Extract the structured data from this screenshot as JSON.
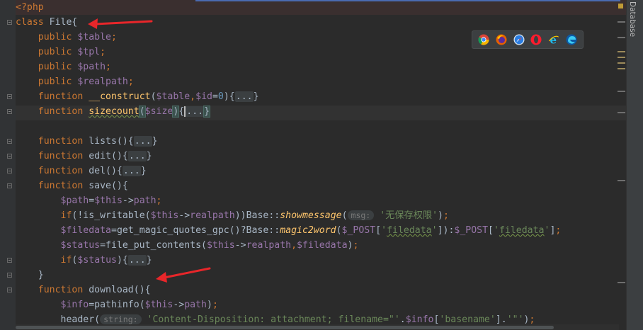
{
  "editor": {
    "language": "php",
    "side_tab_label": "Database",
    "lines": [
      [
        [
          "kw",
          "<?php"
        ]
      ],
      [
        [
          "kw",
          "class "
        ],
        [
          "plain",
          "File{"
        ]
      ],
      [
        [
          "plain",
          "    "
        ],
        [
          "kw",
          "public "
        ],
        [
          "var",
          "$table"
        ],
        [
          "kw",
          ";"
        ]
      ],
      [
        [
          "plain",
          "    "
        ],
        [
          "kw",
          "public "
        ],
        [
          "var",
          "$tpl"
        ],
        [
          "kw",
          ";"
        ]
      ],
      [
        [
          "plain",
          "    "
        ],
        [
          "kw",
          "public "
        ],
        [
          "var",
          "$path"
        ],
        [
          "kw",
          ";"
        ]
      ],
      [
        [
          "plain",
          "    "
        ],
        [
          "kw",
          "public "
        ],
        [
          "var",
          "$realpath"
        ],
        [
          "kw",
          ";"
        ]
      ],
      [
        [
          "plain",
          "    "
        ],
        [
          "kw",
          "function "
        ],
        [
          "fn",
          "__construct"
        ],
        [
          "plain",
          "("
        ],
        [
          "var",
          "$table"
        ],
        [
          "kw",
          ","
        ],
        [
          "var",
          "$id"
        ],
        [
          "plain",
          "="
        ],
        [
          "num",
          "0"
        ],
        [
          "plain",
          "){"
        ],
        [
          "fold",
          "..."
        ],
        [
          "plain",
          "}"
        ]
      ],
      [
        [
          "plain",
          "    "
        ],
        [
          "kw",
          "function "
        ],
        [
          "fnsq",
          "sizecount"
        ],
        [
          "match",
          "("
        ],
        [
          "var",
          "$size"
        ],
        [
          "match",
          ")"
        ],
        [
          "plain",
          "{"
        ],
        [
          "caret",
          ""
        ],
        [
          "fold",
          "..."
        ],
        [
          "match",
          "}"
        ]
      ],
      [],
      [
        [
          "plain",
          "    "
        ],
        [
          "kw",
          "function "
        ],
        [
          "plain",
          "lists(){"
        ],
        [
          "fold",
          "..."
        ],
        [
          "plain",
          "}"
        ]
      ],
      [
        [
          "plain",
          "    "
        ],
        [
          "kw",
          "function "
        ],
        [
          "plain",
          "edit(){"
        ],
        [
          "fold",
          "..."
        ],
        [
          "plain",
          "}"
        ]
      ],
      [
        [
          "plain",
          "    "
        ],
        [
          "kw",
          "function "
        ],
        [
          "plain",
          "del(){"
        ],
        [
          "fold",
          "..."
        ],
        [
          "plain",
          "}"
        ]
      ],
      [
        [
          "plain",
          "    "
        ],
        [
          "kw",
          "function "
        ],
        [
          "plain",
          "save(){"
        ]
      ],
      [
        [
          "plain",
          "        "
        ],
        [
          "var",
          "$path"
        ],
        [
          "plain",
          "="
        ],
        [
          "var",
          "$this"
        ],
        [
          "plain",
          "->"
        ],
        [
          "var",
          "path"
        ],
        [
          "kw",
          ";"
        ]
      ],
      [
        [
          "plain",
          "        "
        ],
        [
          "kw",
          "if"
        ],
        [
          "plain",
          "(!is_writable("
        ],
        [
          "var",
          "$this"
        ],
        [
          "plain",
          "->"
        ],
        [
          "var",
          "realpath"
        ],
        [
          "plain",
          "))Base::"
        ],
        [
          "static",
          "showmessage"
        ],
        [
          "plain",
          "("
        ],
        [
          "hint",
          "msg:"
        ],
        [
          "plain",
          " "
        ],
        [
          "str",
          "'无保存权限'"
        ],
        [
          "plain",
          ")"
        ],
        [
          "kw",
          ";"
        ]
      ],
      [
        [
          "plain",
          "        "
        ],
        [
          "var",
          "$filedata"
        ],
        [
          "plain",
          "=get_magic_quotes_gpc()?Base::"
        ],
        [
          "static",
          "magic2word"
        ],
        [
          "plain",
          "("
        ],
        [
          "var",
          "$_POST"
        ],
        [
          "plain",
          "["
        ],
        [
          "str",
          "'"
        ],
        [
          "strsq",
          "filedata"
        ],
        [
          "str",
          "'"
        ],
        [
          "plain",
          "]):"
        ],
        [
          "var",
          "$_POST"
        ],
        [
          "plain",
          "["
        ],
        [
          "str",
          "'"
        ],
        [
          "strsq",
          "filedata"
        ],
        [
          "str",
          "'"
        ],
        [
          "plain",
          "]"
        ],
        [
          "kw",
          ";"
        ]
      ],
      [
        [
          "plain",
          "        "
        ],
        [
          "var",
          "$status"
        ],
        [
          "plain",
          "=file_put_contents("
        ],
        [
          "var",
          "$this"
        ],
        [
          "plain",
          "->"
        ],
        [
          "var",
          "realpath"
        ],
        [
          "kw",
          ","
        ],
        [
          "var",
          "$filedata"
        ],
        [
          "plain",
          ")"
        ],
        [
          "kw",
          ";"
        ]
      ],
      [
        [
          "plain",
          "        "
        ],
        [
          "kw",
          "if"
        ],
        [
          "plain",
          "("
        ],
        [
          "var",
          "$status"
        ],
        [
          "plain",
          "){"
        ],
        [
          "fold",
          "..."
        ],
        [
          "plain",
          "}"
        ]
      ],
      [
        [
          "plain",
          "    }"
        ]
      ],
      [
        [
          "plain",
          "    "
        ],
        [
          "kw",
          "function "
        ],
        [
          "plain",
          "download(){"
        ]
      ],
      [
        [
          "plain",
          "        "
        ],
        [
          "var",
          "$info"
        ],
        [
          "plain",
          "=pathinfo("
        ],
        [
          "var",
          "$this"
        ],
        [
          "plain",
          "->"
        ],
        [
          "var",
          "path"
        ],
        [
          "plain",
          ")"
        ],
        [
          "kw",
          ";"
        ]
      ],
      [
        [
          "plain",
          "        header("
        ],
        [
          "hint",
          "string:"
        ],
        [
          "plain",
          " "
        ],
        [
          "str",
          "'Content-Disposition: attachment; filename=\"'"
        ],
        [
          "plain",
          "."
        ],
        [
          "var",
          "$info"
        ],
        [
          "plain",
          "["
        ],
        [
          "str",
          "'basename'"
        ],
        [
          "plain",
          "]."
        ],
        [
          "str",
          "'\"'"
        ],
        [
          "plain",
          ")"
        ],
        [
          "kw",
          ";"
        ]
      ]
    ]
  },
  "browser_icons": [
    "chrome-icon",
    "firefox-icon",
    "safari-icon",
    "opera-icon",
    "ie-icon",
    "edge-icon"
  ],
  "colors": {
    "keyword": "#cc7832",
    "variable": "#9876aa",
    "function_name": "#ffc66d",
    "string": "#6a8759",
    "number": "#6897bb",
    "arrow": "#e8262a"
  }
}
